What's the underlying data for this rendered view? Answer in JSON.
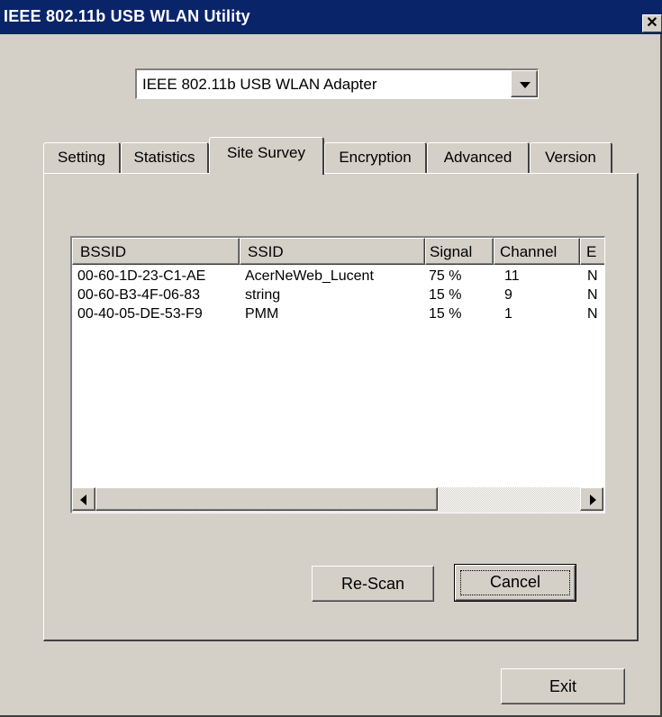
{
  "window": {
    "title": "IEEE 802.11b USB WLAN Utility",
    "close_glyph": "✕"
  },
  "adapter_select": {
    "value": "IEEE 802.11b USB WLAN Adapter"
  },
  "tabs": [
    {
      "label": "Setting",
      "active": false
    },
    {
      "label": "Statistics",
      "active": false
    },
    {
      "label": "Site Survey",
      "active": true
    },
    {
      "label": "Encryption",
      "active": false
    },
    {
      "label": "Advanced",
      "active": false
    },
    {
      "label": "Version",
      "active": false
    }
  ],
  "site_survey": {
    "columns": [
      "BSSID",
      "SSID",
      "Signal",
      "Channel",
      "E"
    ],
    "rows": [
      {
        "bssid": "00-60-1D-23-C1-AE",
        "ssid": "AcerNeWeb_Lucent",
        "signal": "75 %",
        "channel": "11",
        "extra": "N"
      },
      {
        "bssid": "00-60-B3-4F-06-83",
        "ssid": "string",
        "signal": "15 %",
        "channel": "9",
        "extra": "N"
      },
      {
        "bssid": "00-40-05-DE-53-F9",
        "ssid": "PMM",
        "signal": "15 %",
        "channel": "1",
        "extra": "N"
      }
    ],
    "rescan_label": "Re-Scan",
    "cancel_label": "Cancel"
  },
  "footer": {
    "exit_label": "Exit"
  },
  "colors": {
    "titlebar": "#0a246a",
    "face": "#d4d0c8"
  },
  "icons": {
    "close": "close-icon",
    "dropdown": "chevron-down-icon",
    "scroll_left": "scroll-left-icon",
    "scroll_right": "scroll-right-icon"
  }
}
